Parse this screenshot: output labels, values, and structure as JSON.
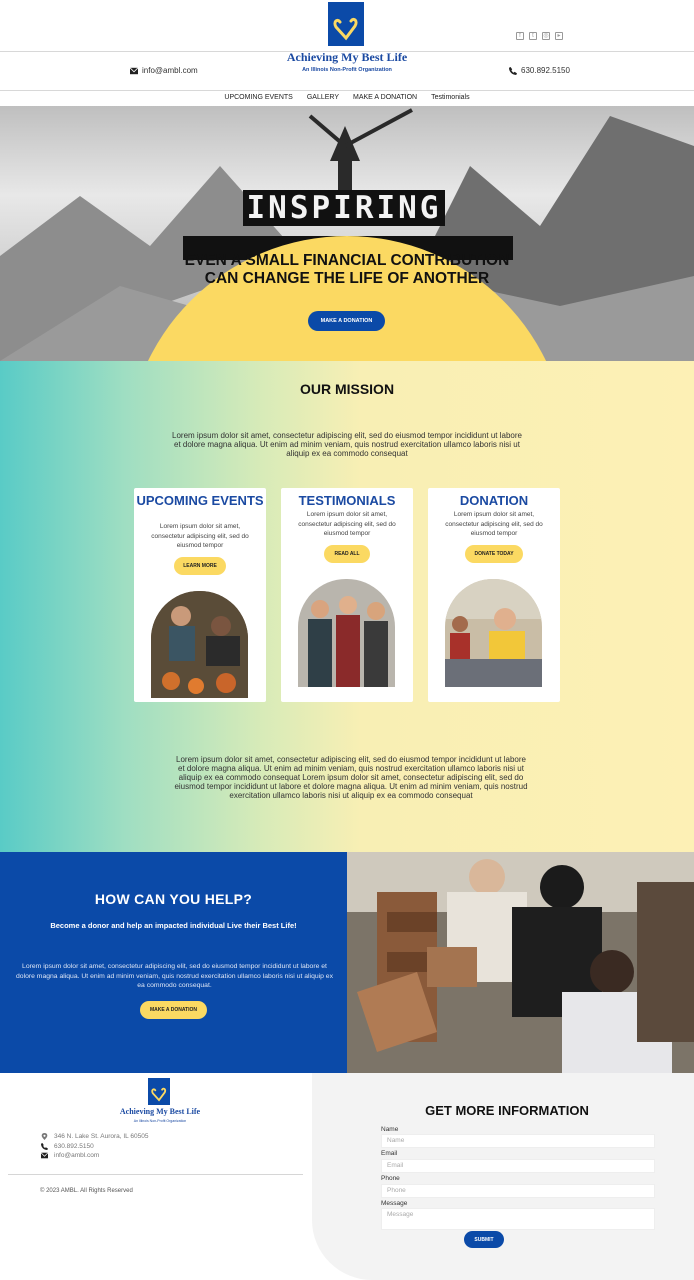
{
  "brand": {
    "name": "Achieving My Best Life",
    "tagline": "An Illinois Non-Profit Organization"
  },
  "header": {
    "email": "info@ambl.com",
    "phone": "630.892.5150",
    "socials": [
      "facebook-icon",
      "twitter-icon",
      "instagram-icon",
      "youtube-icon"
    ]
  },
  "nav": {
    "items": [
      {
        "label": "UPCOMING EVENTS"
      },
      {
        "label": "GALLERY"
      },
      {
        "label": "MAKE A DONATION"
      },
      {
        "label": "Testimonials"
      }
    ]
  },
  "hero": {
    "banner_text": "INSPIRING",
    "title": "EVEN A SMALL FINANCIAL CONTRIBUTION CAN CHANGE THE LIFE OF ANOTHER",
    "button": "MAKE A DONATION"
  },
  "mission": {
    "title": "OUR MISSION",
    "intro": "Lorem ipsum dolor sit amet, consectetur adipiscing elit, sed do eiusmod tempor incididunt ut labore et dolore magna aliqua. Ut enim ad minim veniam, quis nostrud exercitation ullamco laboris nisi ut aliquip ex ea commodo consequat",
    "cards": [
      {
        "title": "UPCOMING EVENTS",
        "text": "Lorem ipsum dolor sit amet, consectetur adipiscing elit, sed do eiusmod tempor",
        "button": "LEARN MORE"
      },
      {
        "title": "TESTIMONIALS",
        "text": "Lorem ipsum dolor sit amet, consectetur adipiscing elit, sed do eiusmod tempor",
        "button": "READ ALL"
      },
      {
        "title": "DONATION",
        "text": "Lorem ipsum dolor sit amet, consectetur adipiscing elit, sed do eiusmod tempor",
        "button": "DONATE TODAY"
      }
    ],
    "outro": "Lorem ipsum dolor sit amet, consectetur adipiscing elit, sed do eiusmod tempor incididunt ut labore et dolore magna aliqua. Ut enim ad minim veniam, quis nostrud exercitation ullamco laboris nisi ut aliquip ex ea commodo consequat Lorem ipsum dolor sit amet, consectetur adipiscing elit, sed do eiusmod tempor incididunt ut labore et dolore magna aliqua. Ut enim ad minim veniam, quis nostrud exercitation ullamco laboris nisi ut aliquip ex ea commodo consequat"
  },
  "help": {
    "title": "HOW CAN YOU HELP?",
    "subtitle": "Become a donor and help an impacted individual Live their Best Life!",
    "text": "Lorem ipsum dolor sit amet, consectetur adipiscing elit, sed do eiusmod tempor incididunt ut labore et dolore magna aliqua. Ut enim ad minim veniam, quis nostrud exercitation ullamco laboris nisi ut aliquip ex ea commodo consequat.",
    "button": "MAKE A DONATION"
  },
  "footer": {
    "address": "346 N. Lake St. Aurora, IL 60505",
    "phone": "630.892.5150",
    "email": "info@ambl.com",
    "copyright": "© 2023 AMBL. All Rights Reserved"
  },
  "form": {
    "title": "GET MORE INFORMATION",
    "fields": [
      {
        "label": "Name",
        "placeholder": "Name"
      },
      {
        "label": "Email",
        "placeholder": "Email"
      },
      {
        "label": "Phone",
        "placeholder": "Phone"
      },
      {
        "label": "Message",
        "placeholder": "Message"
      }
    ],
    "submit": "SUBMIT"
  },
  "colors": {
    "brand_blue": "#0b4aa8",
    "accent_yellow": "#fbd962",
    "gradient_teal": "#59cbc6",
    "gradient_cream": "#fdf0b5"
  }
}
